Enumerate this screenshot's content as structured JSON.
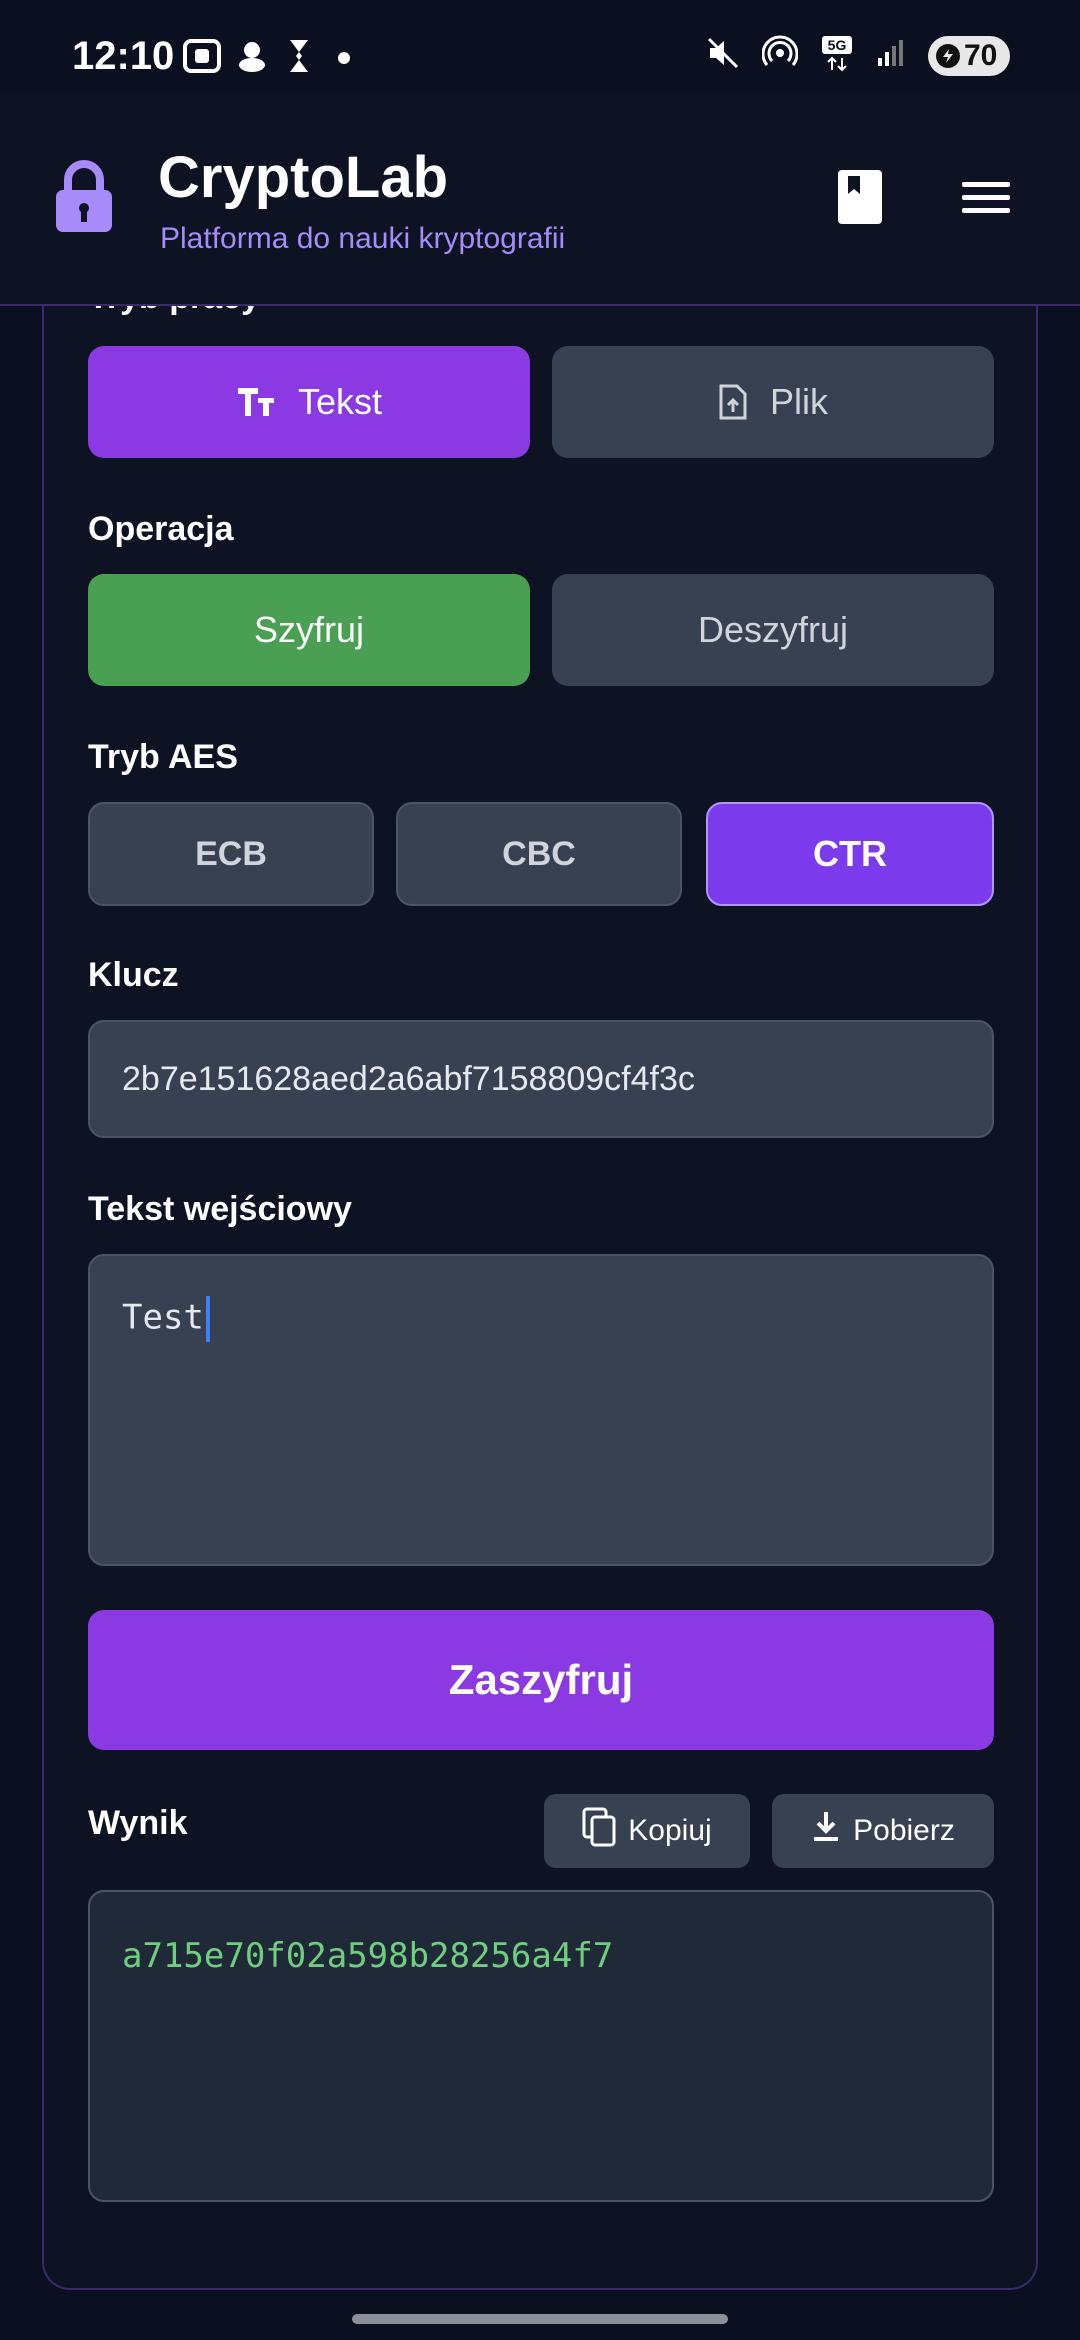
{
  "status_bar": {
    "time": "12:10",
    "battery": "70"
  },
  "header": {
    "title": "CryptoLab",
    "subtitle": "Platforma do nauki kryptografii"
  },
  "work_mode": {
    "label": "Tryb pracy",
    "options": [
      {
        "label": "Tekst",
        "icon": "text-format-icon",
        "selected": true
      },
      {
        "label": "Plik",
        "icon": "file-upload-icon",
        "selected": false
      }
    ]
  },
  "operation": {
    "label": "Operacja",
    "options": [
      {
        "label": "Szyfruj",
        "selected": true
      },
      {
        "label": "Deszyfruj",
        "selected": false
      }
    ]
  },
  "aes_mode": {
    "label": "Tryb AES",
    "options": [
      {
        "label": "ECB",
        "selected": false
      },
      {
        "label": "CBC",
        "selected": false
      },
      {
        "label": "CTR",
        "selected": true
      }
    ]
  },
  "key": {
    "label": "Klucz",
    "value": "2b7e151628aed2a6abf7158809cf4f3c"
  },
  "input_text": {
    "label": "Tekst wejściowy",
    "value": "Test"
  },
  "action_button": {
    "label": "Zaszyfruj"
  },
  "result": {
    "label": "Wynik",
    "copy_label": "Kopiuj",
    "download_label": "Pobierz",
    "value": "a715e70f02a598b28256a4f7"
  },
  "colors": {
    "accent_purple": "#8b3ae3",
    "selected_violet": "#7c3aed",
    "success_green": "#4aa052",
    "result_text": "#6fcf7f",
    "subtitle": "#a78bfa"
  }
}
